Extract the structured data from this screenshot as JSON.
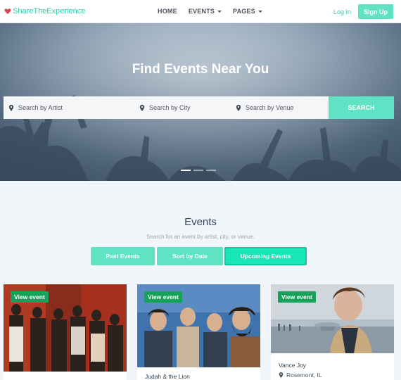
{
  "navbar": {
    "brand": "ShareTheExperience",
    "links": [
      {
        "label": "HOME",
        "has_caret": false
      },
      {
        "label": "EVENTS",
        "has_caret": true
      },
      {
        "label": "PAGES",
        "has_caret": true
      }
    ],
    "login_label": "Log In",
    "signup_label": "Sign Up"
  },
  "hero": {
    "title": "Find Events Near You",
    "search": {
      "artist_placeholder": "Search by Artist",
      "city_placeholder": "Search by City",
      "venue_placeholder": "Search by Venue",
      "button_label": "SEARCH"
    },
    "carousel": {
      "slides": 3,
      "active_index": 0
    }
  },
  "events": {
    "title": "Events",
    "subtitle": "Search for an event by artist, city, or venue.",
    "filters": [
      "Past Events",
      "Sort by Date",
      "Upcoming Events"
    ],
    "active_filter": "Upcoming Events",
    "cards": [
      {
        "view_label": "View event",
        "artist": "",
        "location": ""
      },
      {
        "view_label": "View event",
        "artist": "Judah & the Lion",
        "location": ""
      },
      {
        "view_label": "View event",
        "artist": "Vance Joy",
        "location": "Rosemont, IL"
      }
    ]
  },
  "colors": {
    "accent": "#5fe3c4",
    "accent_text": "#2ecfa8",
    "active_filter": "#19e6b6",
    "view_button": "#16a25b",
    "heart": "#e0454f"
  },
  "icons": [
    "heart-icon",
    "caret-down-icon",
    "map-pin-icon"
  ]
}
